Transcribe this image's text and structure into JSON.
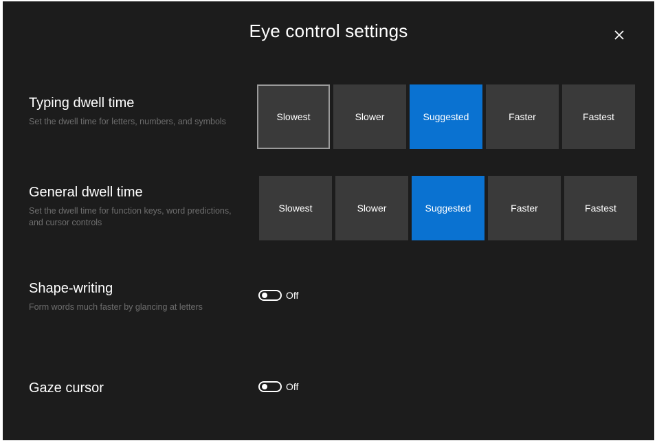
{
  "header": {
    "title": "Eye control settings",
    "close_icon": "close-icon"
  },
  "colors": {
    "background": "#1c1c1c",
    "button": "#3a3a3a",
    "accent": "#0a72d1",
    "description": "#6e6e6e"
  },
  "typing_dwell": {
    "title": "Typing dwell time",
    "description": "Set the dwell time for letters, numbers, and symbols",
    "options": [
      "Slowest",
      "Slower",
      "Suggested",
      "Faster",
      "Fastest"
    ],
    "selected": "Suggested",
    "focused": "Slowest"
  },
  "general_dwell": {
    "title": "General dwell time",
    "description": "Set the dwell time for function keys, word predictions, and cursor controls",
    "options": [
      "Slowest",
      "Slower",
      "Suggested",
      "Faster",
      "Fastest"
    ],
    "selected": "Suggested"
  },
  "shape_writing": {
    "title": "Shape-writing",
    "description": "Form words much faster by glancing at letters",
    "toggle_state": "Off"
  },
  "gaze_cursor": {
    "title": "Gaze cursor",
    "toggle_state": "Off"
  }
}
